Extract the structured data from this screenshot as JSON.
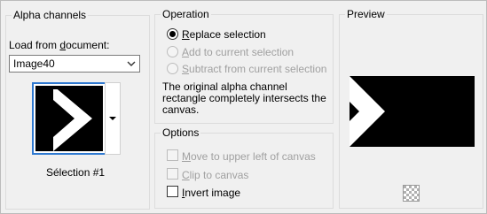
{
  "alpha_channels": {
    "title": "Alpha channels",
    "load_from_label": "Load from document:",
    "load_from_accel": "d",
    "document_value": "Image40",
    "selection_caption": "Sélection #1"
  },
  "operation": {
    "title": "Operation",
    "options": [
      {
        "label": "Replace selection",
        "accel": "R",
        "selected": true,
        "enabled": true
      },
      {
        "label": "Add to current selection",
        "accel": "A",
        "selected": false,
        "enabled": false
      },
      {
        "label": "Subtract from current selection",
        "accel": "S",
        "selected": false,
        "enabled": false
      }
    ],
    "description": "The original alpha channel rectangle completely intersects the canvas."
  },
  "options": {
    "title": "Options",
    "items": [
      {
        "label": "Move to upper left of canvas",
        "accel": "M",
        "checked": false,
        "enabled": false
      },
      {
        "label": "Clip to canvas",
        "accel": "C",
        "checked": false,
        "enabled": false
      },
      {
        "label": "Invert image",
        "accel": "I",
        "checked": false,
        "enabled": true
      }
    ]
  },
  "preview": {
    "title": "Preview"
  }
}
